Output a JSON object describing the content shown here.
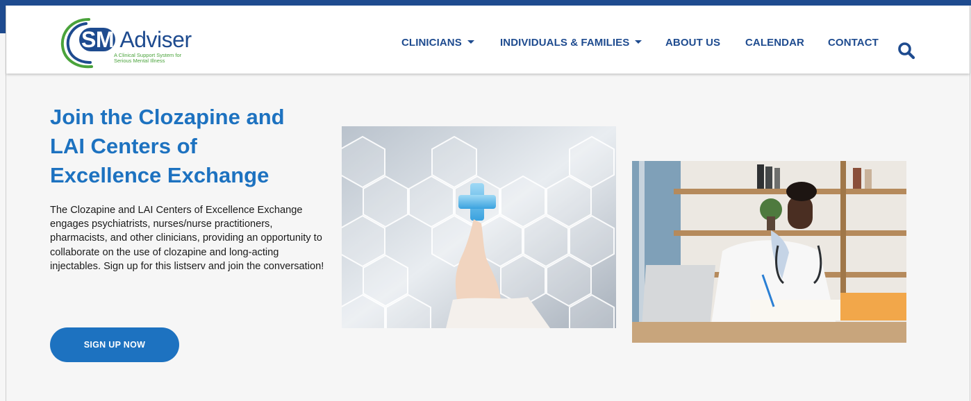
{
  "brand": {
    "smi": "SMI",
    "adviser": "Adviser",
    "tagline_line1": "A Clinical Support System for",
    "tagline_line2": "Serious Mental Illness",
    "colors": {
      "navy": "#1e4b8f",
      "green": "#4aa33b",
      "blue": "#1d72c0"
    }
  },
  "nav": {
    "items": [
      {
        "label": "CLINICIANS",
        "has_dropdown": true
      },
      {
        "label": "INDIVIDUALS & FAMILIES",
        "has_dropdown": true
      },
      {
        "label": "ABOUT US",
        "has_dropdown": false
      },
      {
        "label": "CALENDAR",
        "has_dropdown": false
      },
      {
        "label": "CONTACT",
        "has_dropdown": false
      }
    ],
    "search_icon": "search-icon"
  },
  "hero": {
    "title_line1": "Join the Clozapine and",
    "title_line2": "LAI Centers of",
    "title_line3": "Excellence Exchange",
    "description": "The Clozapine and LAI Centers of Excellence Exchange engages psychiatrists, nurses/nurse practitioners, pharmacists, and other clinicians, providing an opportunity to collaborate on the use of clozapine and long-acting injectables. Sign up for this listserv and join the conversation!",
    "cta_label": "SIGN UP NOW"
  },
  "images": [
    {
      "name": "hexagon-medical-cross-photo"
    },
    {
      "name": "doctor-at-laptop-photo"
    }
  ]
}
